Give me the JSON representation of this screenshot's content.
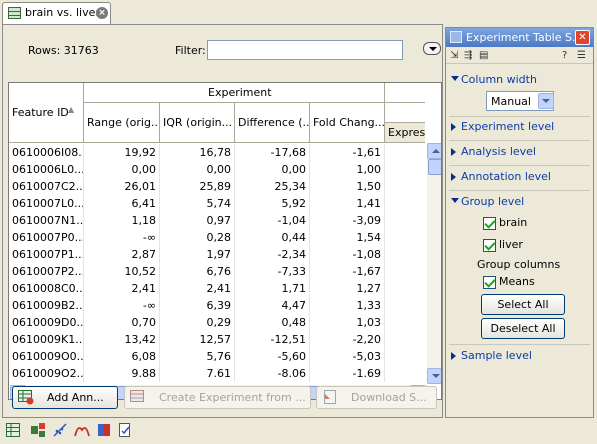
{
  "tab": {
    "label": "brain vs. liver",
    "close": "×"
  },
  "main": {
    "rows_label": "Rows: 31763",
    "filter_label": "Filter:",
    "filter_value": ""
  },
  "table": {
    "group_header": "Experiment",
    "columns": [
      "Feature ID",
      "Range (orig...",
      "IQR (origin...",
      "Difference (...",
      "Fold Chang...",
      "Express"
    ],
    "rows": [
      [
        "0610006I08...",
        "19,92",
        "16,78",
        "-17,68",
        "-1,61"
      ],
      [
        "0610006L0...",
        "0,00",
        "0,00",
        "0,00",
        "1,00"
      ],
      [
        "0610007C2...",
        "26,01",
        "25,89",
        "25,34",
        "1,50"
      ],
      [
        "0610007L0...",
        "6,41",
        "5,74",
        "5,92",
        "1,41"
      ],
      [
        "0610007N1...",
        "1,18",
        "0,97",
        "-1,04",
        "-3,09"
      ],
      [
        "0610007P0...",
        "-∞",
        "0,28",
        "0,44",
        "1,54"
      ],
      [
        "0610007P1...",
        "2,87",
        "1,97",
        "-2,34",
        "-1,08"
      ],
      [
        "0610007P2...",
        "10,52",
        "6,76",
        "-7,33",
        "-1,67"
      ],
      [
        "0610008C0...",
        "2,41",
        "2,41",
        "1,71",
        "1,27"
      ],
      [
        "0610009B2...",
        "-∞",
        "6,39",
        "4,47",
        "1,33"
      ],
      [
        "0610009D0...",
        "0,70",
        "0,29",
        "0,48",
        "1,03"
      ],
      [
        "0610009K1...",
        "13,42",
        "12,57",
        "-12,51",
        "-2,20"
      ],
      [
        "0610009O0...",
        "6,08",
        "5,76",
        "-5,60",
        "-5,03"
      ],
      [
        "0610009O2...",
        "9.88",
        "7.61",
        "-8.06",
        "-1.69"
      ]
    ]
  },
  "buttons": {
    "add_annotations": "Add Ann...",
    "create_experiment": "Create Experiment from ...",
    "download": "Download S..."
  },
  "side_panel": {
    "title": "Experiment Table S...",
    "help": "?",
    "sections": {
      "column_width": "Column width",
      "experiment_level": "Experiment level",
      "analysis_level": "Analysis level",
      "annotation_level": "Annotation level",
      "group_level": "Group level",
      "sample_level": "Sample level"
    },
    "column_width_value": "Manual",
    "group_items": [
      "brain",
      "liver"
    ],
    "group_columns_label": "Group columns",
    "means_label": "Means",
    "select_all": "Select All",
    "deselect_all": "Deselect All"
  },
  "colors": {
    "title_bar": "#4a78c6",
    "section_link": "#0b3aa8",
    "button_border": "#003c74"
  },
  "icons": {
    "tab": "table-icon",
    "bottom_toolbar": [
      "table-view-icon",
      "tree-view-icon",
      "scatter-plot-icon",
      "volcano-plot-icon",
      "book-icon",
      "report-icon"
    ]
  }
}
